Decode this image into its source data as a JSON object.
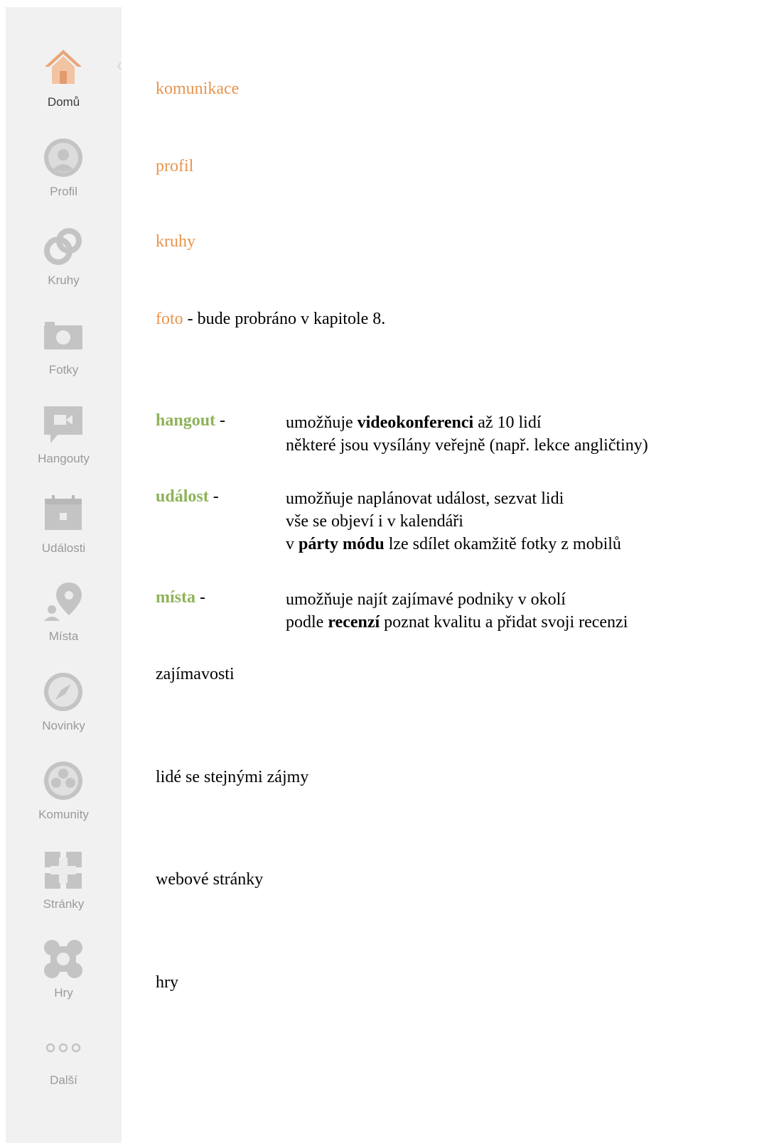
{
  "sidebar": {
    "items": [
      {
        "label": "Domů",
        "icon": "home-icon",
        "active": true
      },
      {
        "label": "Profil",
        "icon": "profile-icon"
      },
      {
        "label": "Kruhy",
        "icon": "circles-icon"
      },
      {
        "label": "Fotky",
        "icon": "camera-icon"
      },
      {
        "label": "Hangouty",
        "icon": "video-camera-icon"
      },
      {
        "label": "Události",
        "icon": "calendar-icon"
      },
      {
        "label": "Místa",
        "icon": "map-pin-icon"
      },
      {
        "label": "Novinky",
        "icon": "compass-icon"
      },
      {
        "label": "Komunity",
        "icon": "community-icon"
      },
      {
        "label": "Stránky",
        "icon": "pages-icon"
      },
      {
        "label": "Hry",
        "icon": "gamepad-icon"
      },
      {
        "label": "Další",
        "icon": "more-dots-icon"
      }
    ]
  },
  "content": {
    "komunikace": "komunikace",
    "profil": "profil",
    "kruhy": "kruhy",
    "foto": {
      "term": "foto",
      "rest": " - bude probráno v kapitole 8."
    },
    "hangout": {
      "term": "hangout",
      "sep": " -",
      "line1_pre": "umožňuje ",
      "line1_bold": "videokonferenci",
      "line1_post": " až 10 lidí",
      "line2": "některé jsou vysílány veřejně (např. lekce angličtiny)"
    },
    "udalost": {
      "term": "událost",
      "sep": " -",
      "line1": "umožňuje naplánovat událost, sezvat lidi",
      "line2": "vše se objeví i v kalendáři",
      "line3_pre": "v ",
      "line3_bold": "párty módu",
      "line3_post": " lze sdílet okamžitě fotky z mobilů"
    },
    "mista": {
      "term": "místa",
      "sep": " -",
      "line1": "umožňuje najít zajímavé podniky v okolí",
      "line2_pre": "podle ",
      "line2_bold": "recenzí",
      "line2_post": " poznat kvalitu a přidat svoji recenzi"
    },
    "zajimavosti": "zajímavosti",
    "lide": "lidé se stejnými zájmy",
    "webove": "webové stránky",
    "hry": "hry"
  },
  "colors": {
    "orange": "#e8954e",
    "green": "#8fb35a",
    "sidebar_bg": "#f1f1f1",
    "icon_gray": "#c4c4c4"
  }
}
